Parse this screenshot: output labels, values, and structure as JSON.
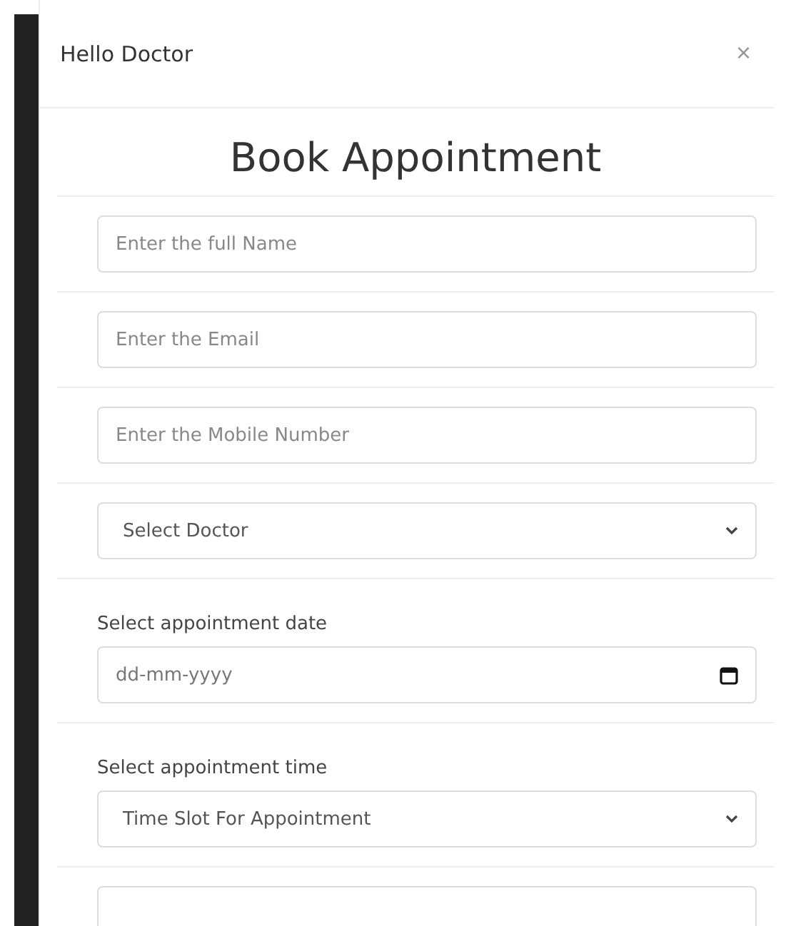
{
  "modal": {
    "title": "Hello Doctor",
    "close": "×"
  },
  "heading": "Book Appointment",
  "fields": [
    {
      "kind": "input",
      "placeholder": "Enter the full Name"
    },
    {
      "kind": "input",
      "placeholder": "Enter the Email"
    },
    {
      "kind": "input",
      "placeholder": "Enter the Mobile Number"
    },
    {
      "kind": "select",
      "value": "Select Doctor"
    },
    {
      "kind": "date",
      "label": "Select appointment date",
      "placeholder": "dd-mm-yyyy"
    },
    {
      "kind": "select",
      "label": "Select appointment time",
      "value": "Time Slot For Appointment"
    },
    {
      "kind": "input"
    }
  ]
}
